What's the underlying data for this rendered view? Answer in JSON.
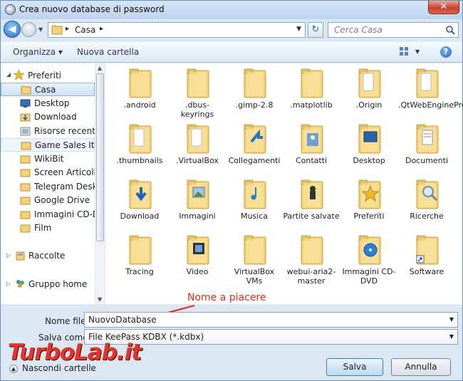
{
  "window": {
    "title": "Crea nuovo database di password",
    "close_glyph": "✕"
  },
  "address": {
    "path": "Casa",
    "search_placeholder": "Cerca Casa"
  },
  "toolbar": {
    "organize": "Organizza ▾",
    "new_folder": "Nuova cartella",
    "help": "?"
  },
  "nav": {
    "favorites": "Preferiti",
    "items": [
      "Casa",
      "Desktop",
      "Download",
      "Risorse recenti",
      "Game Sales Italia",
      "WikiBit",
      "Screen Articoli",
      "Telegram Desktop",
      "Google Drive",
      "Immagini CD-DVD",
      "Film"
    ],
    "libraries": "Raccolte",
    "homegroup": "Gruppo home"
  },
  "files": [
    ".android",
    ".dbus-keyrings",
    ".gimp-2.8",
    ".matplotlib",
    ".Origin",
    ".QtWebEngineProcess",
    ".thumbnails",
    ".VirtualBox",
    "Collegamenti",
    "Contatti",
    "Desktop",
    "Documenti",
    "Download",
    "Immagini",
    "Musica",
    "Partite salvate",
    "Preferiti",
    "Ricerche",
    "Tracing",
    "Video",
    "VirtualBox VMs",
    "webui-aria2-master",
    "Immagini CD-DVD",
    "Software"
  ],
  "filename": {
    "label": "Nome file:",
    "value": "NuovoDatabase"
  },
  "filetype": {
    "label": "Salva come:",
    "value": "File KeePass KDBX (*.kdbx)"
  },
  "annotation": "Nome a piacere",
  "hide_folders": "Nascondi cartelle",
  "buttons": {
    "save": "Salva",
    "cancel": "Annulla"
  },
  "watermark": "TurboLab.it",
  "colors": {
    "folder": "#f3d27a",
    "selection": "#cfe2f7",
    "annotation": "#e0261c",
    "watermark": "#e3352a"
  }
}
